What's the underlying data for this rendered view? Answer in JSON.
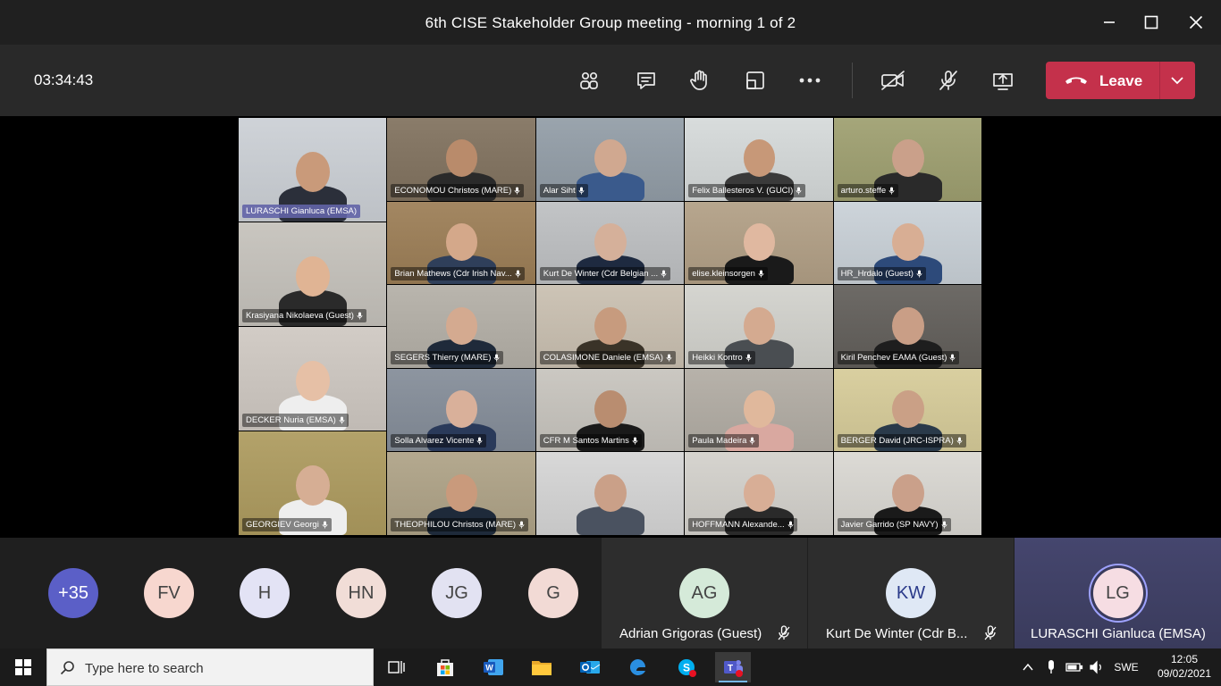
{
  "window": {
    "title": "6th CISE Stakeholder Group meeting - morning 1 of 2"
  },
  "toolbar": {
    "timer": "03:34:43",
    "leave_label": "Leave"
  },
  "participants": [
    {
      "name": "LURASCHI Gianluca (EMSA)",
      "active": true,
      "bg": "#cfd3d8",
      "skin": "#c99a7a",
      "shirt": "#2b2f3a"
    },
    {
      "name": "ECONOMOU Christos (MARE)",
      "bg": "#8a7c6a",
      "skin": "#b98b6b",
      "shirt": "#2a2a2a"
    },
    {
      "name": "Alar Siht",
      "bg": "#9aa4ad",
      "skin": "#d0a890",
      "shirt": "#3a5a8c"
    },
    {
      "name": "Felix Ballesteros V. (GUCI)",
      "bg": "#d8dcdc",
      "skin": "#c79878",
      "shirt": "#3a3a3a"
    },
    {
      "name": "arturo.steffe",
      "bg": "#a5a67a",
      "skin": "#caa08a",
      "shirt": "#2a2a2a"
    },
    {
      "name": "Krasiyana Nikolaeva (Guest)",
      "bg": "#c9c6c0",
      "skin": "#e0b494",
      "shirt": "#2a2a2a"
    },
    {
      "name": "Brian Mathews (Cdr Irish Nav...",
      "bg": "#a38762",
      "skin": "#d4a88a",
      "shirt": "#2f3f5a"
    },
    {
      "name": "Kurt De Winter (Cdr Belgian ...",
      "bg": "#c2c4c6",
      "skin": "#d5b09a",
      "shirt": "#1e2a40"
    },
    {
      "name": "elise.kleinsorgen",
      "bg": "#b7a68e",
      "skin": "#e0b8a0",
      "shirt": "#1a1a1a"
    },
    {
      "name": "HR_Hrdalo (Guest)",
      "bg": "#cdd4da",
      "skin": "#d8ae94",
      "shirt": "#2d4a7a"
    },
    {
      "name": "SEGERS Thierry (MARE)",
      "bg": "#b9b5ad",
      "skin": "#d4aa90",
      "shirt": "#1f2a3a"
    },
    {
      "name": "COLASIMONE Daniele (EMSA)",
      "bg": "#cdc4b6",
      "skin": "#c79b7e",
      "shirt": "#3a3328"
    },
    {
      "name": "Heikki Kontro",
      "bg": "#d5d5d0",
      "skin": "#d4aa90",
      "shirt": "#4a4e52"
    },
    {
      "name": "Kiril Penchev EAMA (Guest)",
      "bg": "#6d6a66",
      "skin": "#c99e86",
      "shirt": "#1e1e1e"
    },
    {
      "name": "DECKER Nuria (EMSA)",
      "bg": "#d2ccc6",
      "skin": "#e6c0a6",
      "shirt": "#eeeeee"
    },
    {
      "name": "Solla Alvarez Vicente",
      "bg": "#8d95a0",
      "skin": "#d9b09a",
      "shirt": "#2a3a5a"
    },
    {
      "name": "CFR M Santos Martins",
      "bg": "#cbc8c2",
      "skin": "#b98d70",
      "shirt": "#1a1a1a"
    },
    {
      "name": "Paula Madeira",
      "bg": "#b7b2aa",
      "skin": "#e0b89c",
      "shirt": "#d9a8a0"
    },
    {
      "name": "BERGER David (JRC-ISPRA)",
      "bg": "#d9cfa0",
      "skin": "#caa086",
      "shirt": "#2a3a4a"
    },
    {
      "name": "GEORGIEV Georgi",
      "bg": "#b3a26a",
      "skin": "#d6ae94",
      "shirt": "#eeeeee"
    },
    {
      "name": "THEOPHILOU Christos (MARE)",
      "bg": "#b4a98f",
      "skin": "#c99a7c",
      "shirt": "#1e2a3a"
    },
    {
      "name": "",
      "bg": "#d8d8d8",
      "skin": "#caa088",
      "shirt": "#4a5260"
    },
    {
      "name": "HOFFMANN Alexande...",
      "bg": "#d6d4cf",
      "skin": "#d8ae96",
      "shirt": "#2a2a2a"
    },
    {
      "name": "Javier Garrido (SP NAVY)",
      "bg": "#dcdad5",
      "skin": "#caa08a",
      "shirt": "#1a1a1a"
    }
  ],
  "strip": {
    "avatars": [
      {
        "initials": "+35",
        "bg": "#5b5fc7",
        "fg": "#ffffff"
      },
      {
        "initials": "FV",
        "bg": "#f7d7cf",
        "fg": "#444444"
      },
      {
        "initials": "H",
        "bg": "#e3e3f5",
        "fg": "#444444"
      },
      {
        "initials": "HN",
        "bg": "#f1ddd7",
        "fg": "#444444"
      },
      {
        "initials": "JG",
        "bg": "#e2e2f2",
        "fg": "#444444"
      },
      {
        "initials": "G",
        "bg": "#f2dad5",
        "fg": "#444444"
      }
    ],
    "panels": [
      {
        "initials": "AG",
        "name": "Adrian Grigoras (Guest)",
        "bg": "#d5ead9",
        "fg": "#444444"
      },
      {
        "initials": "KW",
        "name": "Kurt De Winter (Cdr B...",
        "bg": "#dfe8f5",
        "fg": "#2a3a8a"
      },
      {
        "initials": "LG",
        "name": "LURASCHI Gianluca (EMSA)",
        "bg": "#f6dde3",
        "fg": "#444444"
      }
    ]
  },
  "taskbar": {
    "search_placeholder": "Type here to search",
    "language": "SWE",
    "time": "12:05",
    "date": "09/02/2021"
  }
}
